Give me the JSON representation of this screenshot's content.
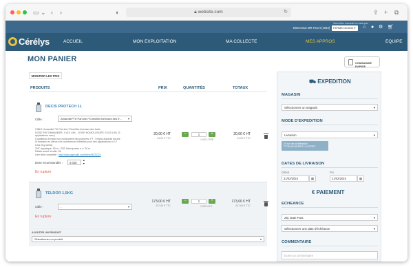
{
  "browser": {
    "url": "website.com",
    "lock_icon": "lock-icon",
    "sidebar_icon": "sidebar-icon",
    "back_icon": "back-icon",
    "forward_icon": "forward-icon",
    "share_icon": "share-icon",
    "newtab_icon": "plus-icon",
    "tabs_icon": "tabs-icon"
  },
  "topbar": {
    "welcome": "Bienvenue MR TECH (1064)",
    "connected_as": "Vous êtes connecté en tant que:",
    "farm_select": "FERME DEMO2"
  },
  "nav": {
    "logo": "Cérélys",
    "items": [
      {
        "label": "ACCUEIL",
        "active": false
      },
      {
        "label": "MON EXPLOITATION",
        "active": false
      },
      {
        "label": "MA COLLECTE",
        "active": false
      },
      {
        "label": "MES APPROS",
        "active": true
      },
      {
        "label": "EQUIPE",
        "active": false
      }
    ]
  },
  "cart": {
    "title": "MON PANIER",
    "quick_order": "COMMANDE RAPIDE",
    "modify_prices": "MODIFIER LES PRIX",
    "columns": {
      "products": "PRODUITS",
      "price": "PRIX",
      "quantities": "QUANTITÉS",
      "totals": "TOTAUX"
    },
    "items": [
      {
        "name": "DECIS PROTECH 1L",
        "target_label": "Cible :",
        "target_value": "Amandier*Trt Part.Aer.*Chenilles foreuses des fr...",
        "description": [
          "CIBLE: Amandier*Trt Part.Aer.*Chenilles foreuses des fruits",
          "DOSE RECOMMANDÉE: 0.010 L/HL - DOSE HOMOLOGUÉE: 0.010 L/HL (3",
          "applications max.)",
          "Conditions d'emploi sur composées des pommes. FT : Emploi autorisé durant",
          "la floraison en dehors de la présence d'abeilles pour des applications à 0,2",
          "L/ha (5 g sa/ha)",
          "ZNT aquatique: 50 m - ZNT Arthropodes n.c: 20 m",
          "Délais avant récolte: 28",
          "Lien fiche complète : "
        ],
        "link": "http://data.agrivalis.com/fiche/5001023",
        "dose_label": "Dose recommandée :",
        "dose_value": "0.010",
        "stock": "En rupture",
        "price_ht": "20,00 € HT",
        "price_ttc": "24,00 € TTC",
        "qty": "1",
        "qty_sub": "1,000 LITRE",
        "total_ht": "20,00 € HT",
        "total_ttc": "24,00 € TTC"
      },
      {
        "name": "TELDOR 1,5KG",
        "target_label": "Cible :",
        "target_value": "-",
        "stock": "En rupture",
        "price_ht": "173,00 € HT",
        "price_ttc": "207,60 € TTC",
        "qty": "1",
        "qty_sub": "1,500 KILO",
        "total_ht": "173,00 € HT",
        "total_ttc": "207,60 € TTC"
      }
    ],
    "add_product": {
      "label": "AJOUTER UN PRODUIT",
      "placeholder": "Sélectionner un produit"
    }
  },
  "panel": {
    "expedition_title": "EXPEDITION",
    "magasin_label": "MAGASIN",
    "magasin_placeholder": "Sélectionner un magasin",
    "mode_label": "MODE D'EXPEDITION",
    "mode_value": "Livraison",
    "relay_line1": "20 rue de la libération",
    "relay_line2": "77760 ACHERES LA FORET",
    "dates_label": "DATES DE LIVRAISON",
    "date_from_label": "Début",
    "date_from": "21/02/2024",
    "date_to_label": "Fin",
    "date_to": "21/02/2024",
    "payment_title": "€ PAIEMENT",
    "echeance_label": "ECHEANCE",
    "echeance_value": "25j. Date Fact.",
    "echeance_date_placeholder": "Sélectionner une date d'échéance",
    "comment_label": "COMMENTAIRE",
    "comment_placeholder": "Ecrire un commentaire"
  }
}
